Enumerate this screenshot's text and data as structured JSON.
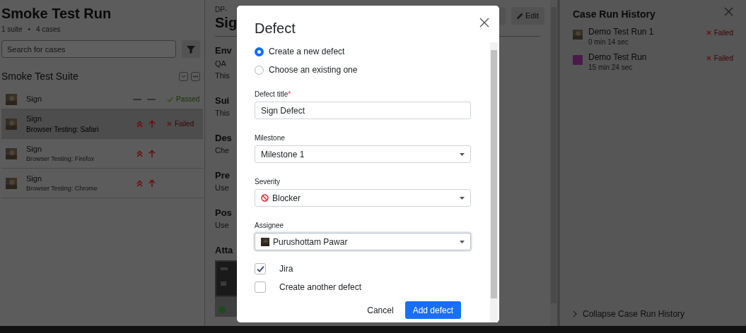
{
  "run": {
    "title": "Smoke Test Run",
    "suites": "1 suite",
    "bullet": "•",
    "cases": "4 cases"
  },
  "search": {
    "placeholder": "Search for cases"
  },
  "suite": {
    "title": "Smoke Test Suite"
  },
  "cases": [
    {
      "name": "Sign",
      "kind": "unprioritized",
      "status": {
        "text": "Passed",
        "kind": "passed"
      },
      "selected": false
    },
    {
      "name": "Sign",
      "detail": "Browser Testing: Safari",
      "kind": "critical",
      "status": {
        "text": "Failed",
        "kind": "failed"
      },
      "selected": true
    },
    {
      "name": "Sign",
      "detail": "Browser Testing: Firefox",
      "kind": "critical",
      "selected": false
    },
    {
      "name": "Sign",
      "detail": "Browser Testing: Chrome",
      "kind": "critical",
      "selected": false
    }
  ],
  "details": {
    "key": "DP-",
    "title": "Sig",
    "edit": "Edit",
    "sections": [
      {
        "heading": "Env",
        "lines": [
          "QA",
          "This"
        ]
      },
      {
        "heading": "Sui",
        "lines": [
          "This"
        ]
      },
      {
        "heading": "Des",
        "lines": [
          "Che"
        ]
      },
      {
        "heading": "Pre",
        "lines": [
          "Use"
        ]
      },
      {
        "heading": "Pos",
        "lines": [
          "Use"
        ]
      },
      {
        "heading": "Atta"
      }
    ]
  },
  "history": {
    "title": "Case Run History",
    "items": [
      {
        "name": "Demo Test Run 1",
        "duration": "0 min 14 sec",
        "status": "Failed"
      },
      {
        "name": "Demo Test Run",
        "duration": "15 min 24 sec",
        "status": "Failed",
        "kind": "tile"
      }
    ],
    "collapse": "Collapse Case Run History"
  },
  "modal": {
    "title": "Defect",
    "options": [
      {
        "label": "Create a new defect",
        "selected": true
      },
      {
        "label": "Choose an existing one",
        "selected": false
      }
    ],
    "fields": [
      {
        "label": "Defect title",
        "required_mark": "*",
        "kind": "text",
        "value": "Sign Defect",
        "focused": false
      },
      {
        "label": "Milestone",
        "kind": "select",
        "value": "Milestone 1",
        "focused": false
      },
      {
        "label": "Severity",
        "kind": "severity",
        "value": "Blocker",
        "focused": false
      },
      {
        "label": "Assignee",
        "kind": "user",
        "value": "Purushottam Pawar",
        "focused": true
      }
    ],
    "checks": [
      {
        "label": "Jira",
        "checked": true
      },
      {
        "label": "Create another defect",
        "checked": false
      }
    ],
    "cancel": "Cancel",
    "submit": "Add defect"
  }
}
